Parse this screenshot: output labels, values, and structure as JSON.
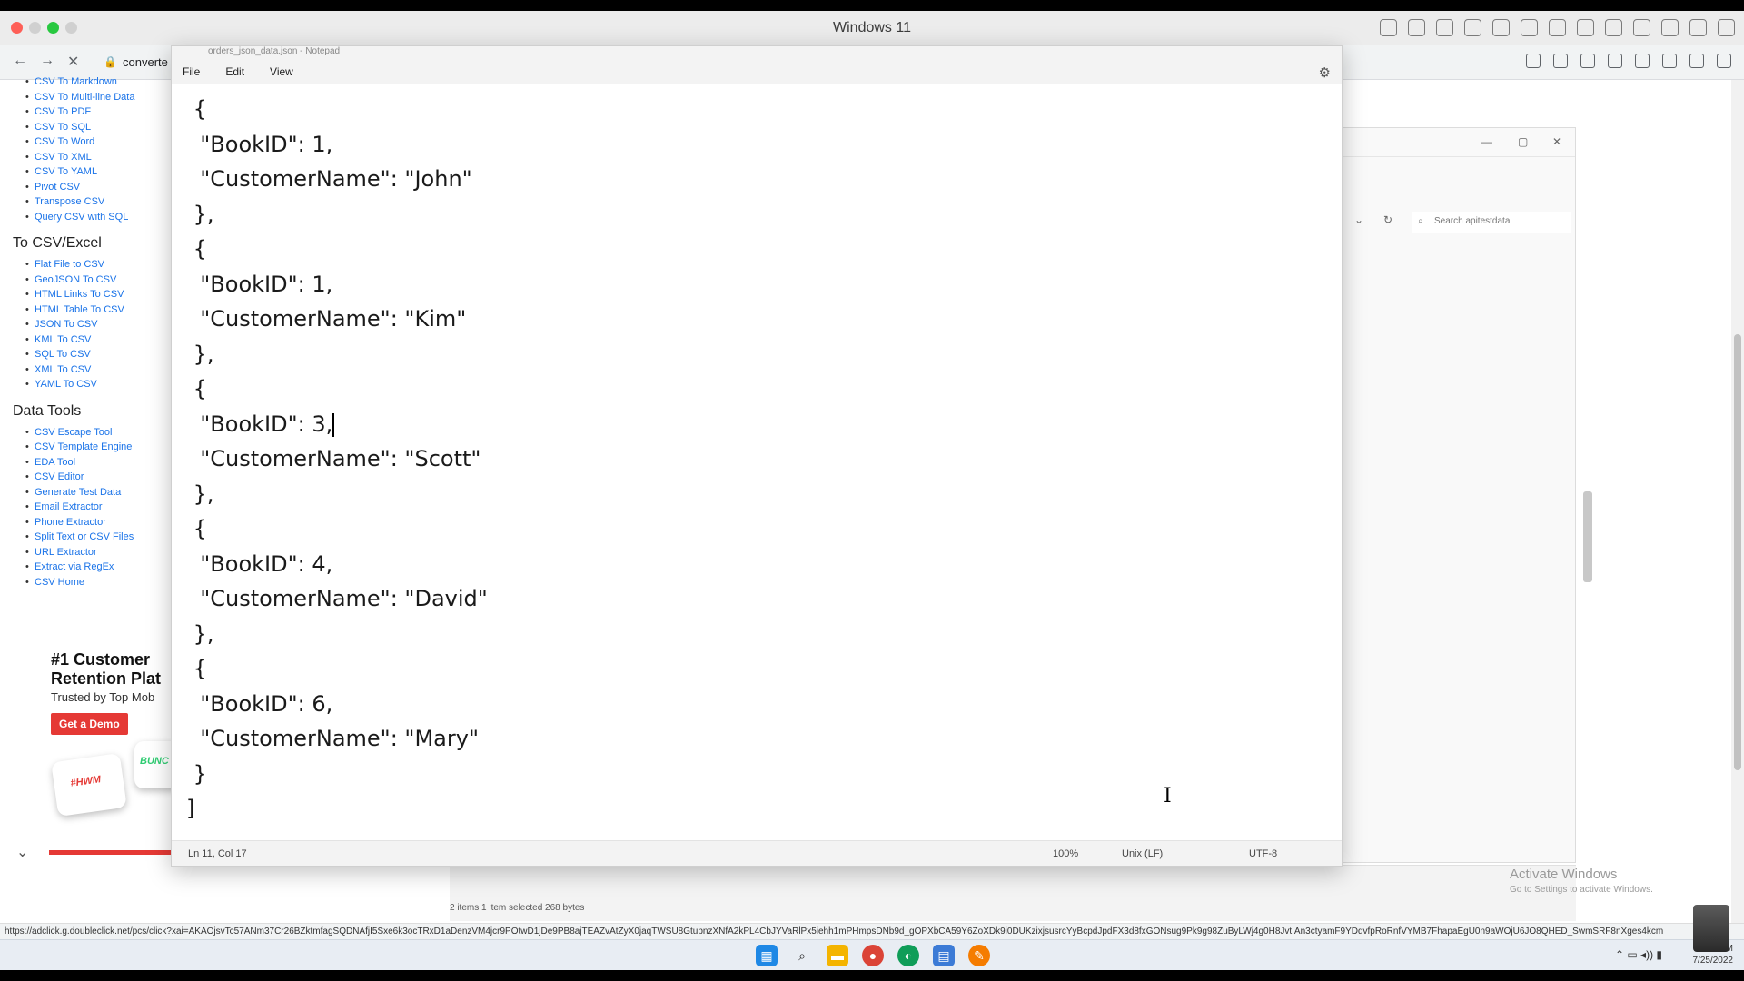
{
  "vm": {
    "title": "Windows 11"
  },
  "browser": {
    "url_partial": "converte"
  },
  "sidebar": {
    "group1": [
      "CSV To Markdown",
      "CSV To Multi-line Data",
      "CSV To PDF",
      "CSV To SQL",
      "CSV To Word",
      "CSV To XML",
      "CSV To YAML",
      "Pivot CSV",
      "Transpose CSV",
      "Query CSV with SQL"
    ],
    "heading2": "To CSV/Excel",
    "group2": [
      "Flat File to CSV",
      "GeoJSON To CSV",
      "HTML Links To CSV",
      "HTML Table To CSV",
      "JSON To CSV",
      "KML To CSV",
      "SQL To CSV",
      "XML To CSV",
      "YAML To CSV"
    ],
    "heading3": "Data Tools",
    "group3": [
      "CSV Escape Tool",
      "CSV Template Engine",
      "EDA Tool",
      "CSV Editor",
      "Generate Test Data",
      "Email Extractor",
      "Phone Extractor",
      "Split Text or CSV Files",
      "URL Extractor",
      "Extract via RegEx",
      "CSV Home"
    ]
  },
  "ad": {
    "title": "#1 Customer Retention Plat",
    "subtitle": "Trusted by Top Mob",
    "button": "Get a Demo",
    "card1": "#HWM",
    "card2": "BUNC"
  },
  "explorer": {
    "search_placeholder": "Search apitestdata",
    "status": "2 items    1 item selected  268 bytes"
  },
  "activate": {
    "line1": "Activate Windows",
    "line2": "Go to Settings to activate Windows."
  },
  "notepad": {
    "title": "orders_json_data.json - Notepad",
    "menu": [
      "File",
      "Edit",
      "View"
    ],
    "lines": [
      " {",
      "  \"BookID\": 1,",
      "  \"CustomerName\": \"John\"",
      " },",
      " {",
      "  \"BookID\": 1,",
      "  \"CustomerName\": \"Kim\"",
      " },",
      " {",
      "  \"BookID\": 3,",
      "  \"CustomerName\": \"Scott\"",
      " },",
      " {",
      "  \"BookID\": 4,",
      "  \"CustomerName\": \"David\"",
      " },",
      " {",
      "  \"BookID\": 6,",
      "  \"CustomerName\": \"Mary\"",
      " }",
      "]"
    ],
    "status": {
      "position": "Ln 11, Col 17",
      "zoom": "100%",
      "eol": "Unix (LF)",
      "encoding": "UTF-8"
    }
  },
  "status_url": "https://adclick.g.doubleclick.net/pcs/click?xai=AKAOjsvTc57ANm37Cr26BZktmfagSQDNAfjI5Sxe6k3ocTRxD1aDenzVM4jcr9POtwD1jDe9PB8ajTEAZvAtZyX0jaqTWSU8GtupnzXNfA2kPL4CbJYVaRlPx5iehh1mPHmpsDNb9d_gOPXbCA59Y6ZoXDk9i0DUKzixjsusrcYyBcpdJpdFX3d8fxGONsug9Pk9g98ZuByLWj4g0H8JvtIAn3ctyamF9YDdvfpRoRnfVYMB7FhapaEgU0n9aWOjU6JO8QHED_SwmSRF8nXges4kcm",
  "tray": {
    "time": "AM",
    "date": "7/25/2022"
  },
  "colors": {
    "link": "#1a73e8",
    "ad_red": "#e53935",
    "taskbar": "#e8edf3"
  }
}
